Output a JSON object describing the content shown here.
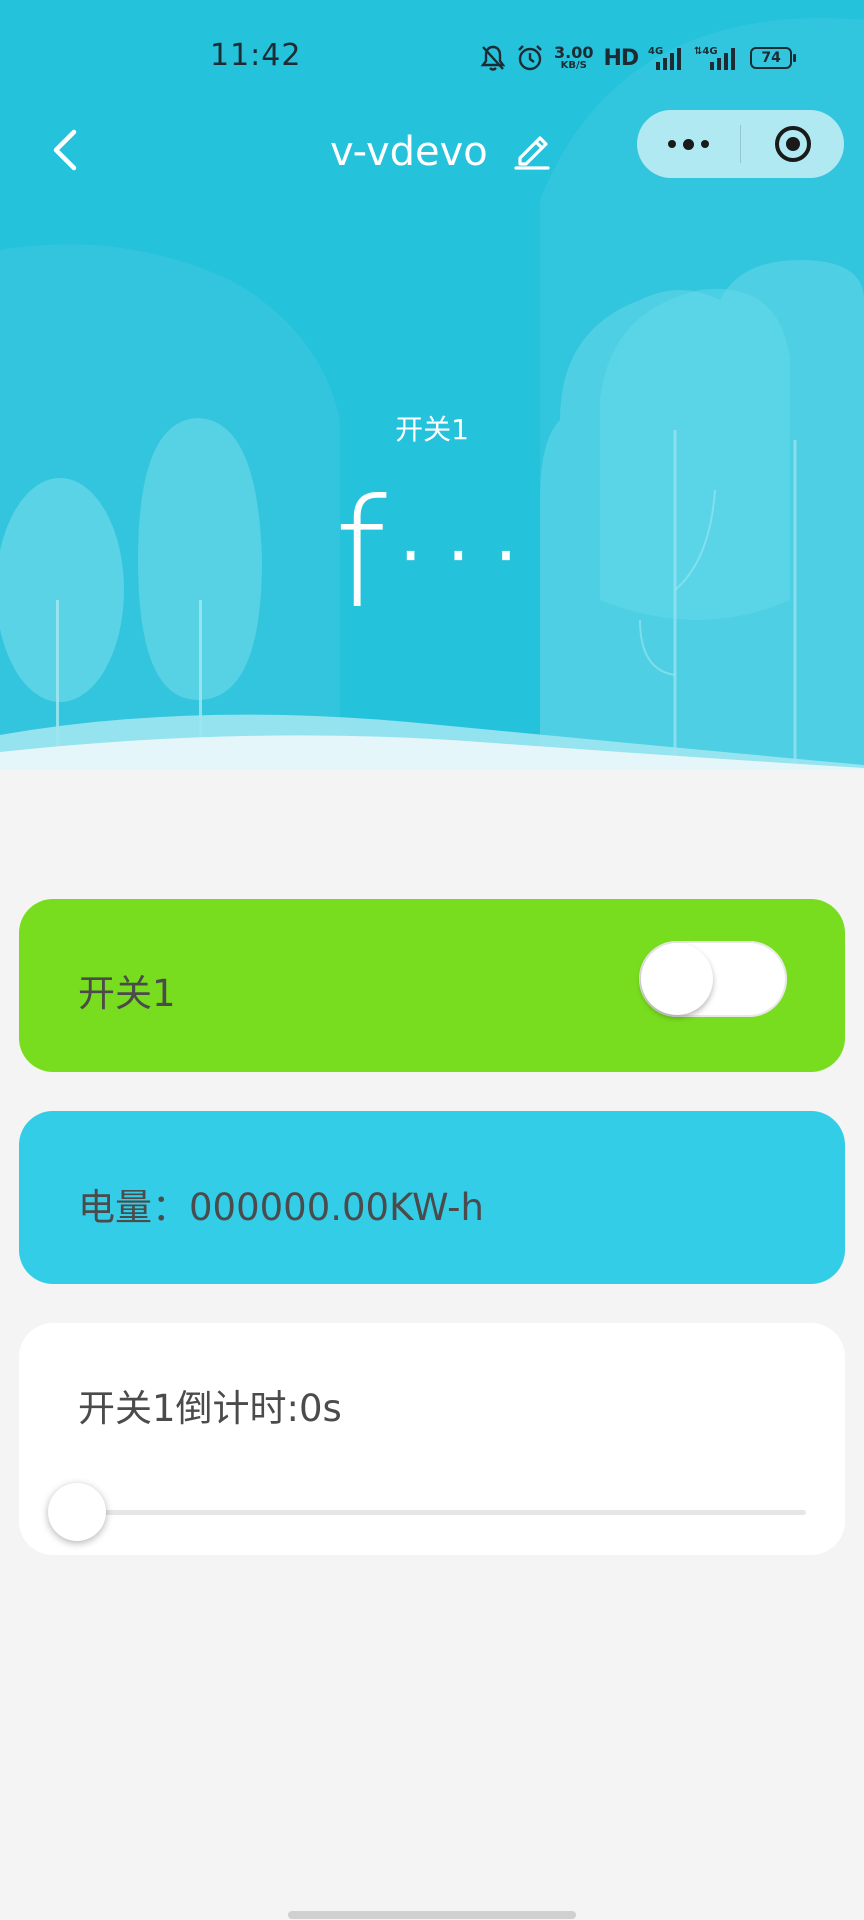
{
  "status_bar": {
    "time": "11:42",
    "net_speed_value": "3.00",
    "net_speed_unit": "KB/S",
    "hd_label": "HD",
    "battery_level": "74"
  },
  "nav": {
    "title": "v-vdevo"
  },
  "hero": {
    "label": "开关1",
    "value": "f···"
  },
  "switch_card": {
    "label": "开关1",
    "toggle_on": false,
    "color": "#78dd1e"
  },
  "power_card": {
    "label": "电量：000000.00KW-h",
    "color": "#33cde8"
  },
  "timer_card": {
    "label": "开关1倒计时:0s",
    "slider_value": 0
  }
}
